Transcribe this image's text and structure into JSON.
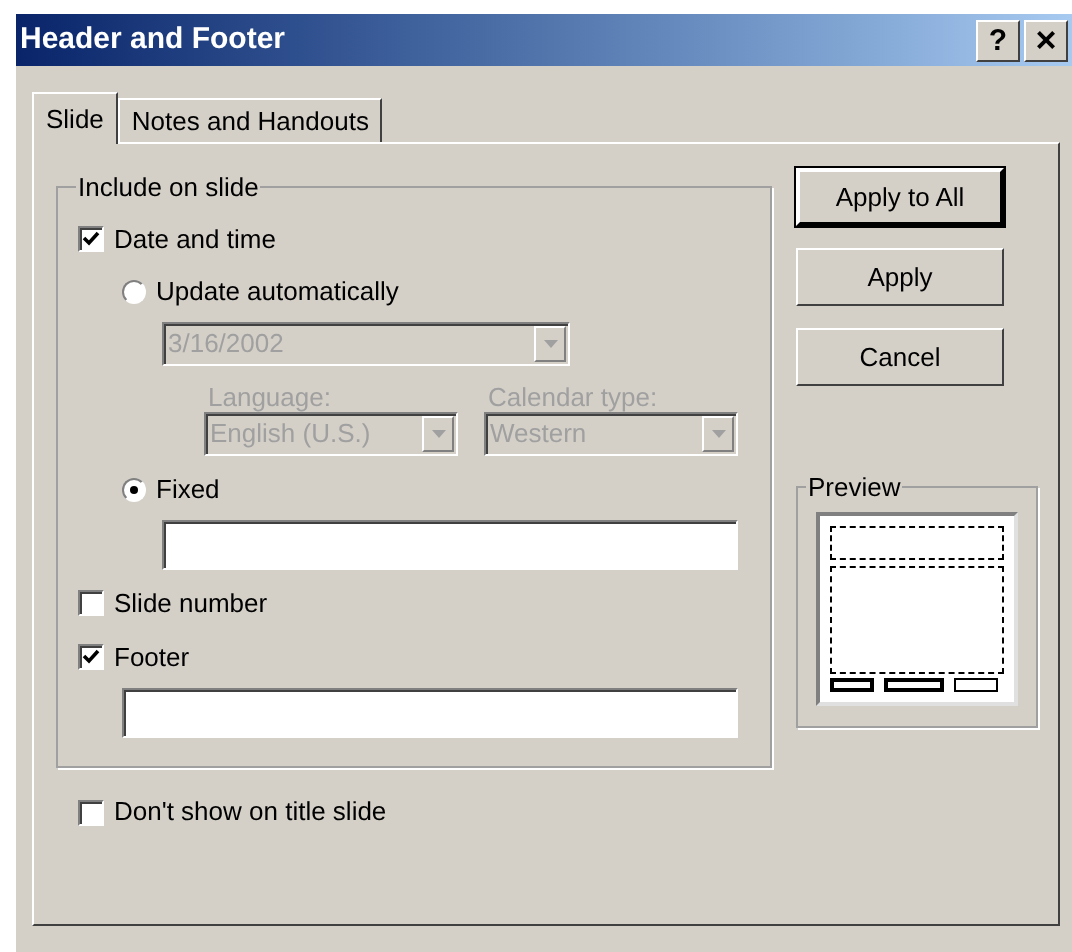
{
  "window": {
    "title": "Header and Footer",
    "help_button": "?",
    "close_button": "×"
  },
  "tabs": [
    {
      "label": "Slide",
      "selected": true
    },
    {
      "label": "Notes and Handouts",
      "selected": false
    }
  ],
  "include_group": {
    "title": "Include on slide",
    "date_and_time": {
      "label": "Date and time",
      "checked": true
    },
    "update_automatically": {
      "label": "Update automatically",
      "selected": false
    },
    "date_combo": {
      "value": "3/16/2002",
      "disabled": true
    },
    "language": {
      "label": "Language:",
      "value": "English (U.S.)",
      "disabled": true
    },
    "calendar_type": {
      "label": "Calendar type:",
      "value": "Western",
      "disabled": true
    },
    "fixed": {
      "label": "Fixed",
      "selected": true
    },
    "slide_number": {
      "label": "Slide number",
      "checked": false
    },
    "footer": {
      "label": "Footer",
      "checked": true
    }
  },
  "dont_show_on_title_slide": {
    "label": "Don't show on title slide",
    "checked": false
  },
  "buttons": [
    {
      "label": "Apply to All",
      "default": true
    },
    {
      "label": "Apply",
      "default": false
    },
    {
      "label": "Cancel",
      "default": false
    }
  ],
  "preview": {
    "title": "Preview",
    "placeholders": [
      {
        "active": true
      },
      {
        "active": true
      },
      {
        "active": false
      }
    ]
  }
}
